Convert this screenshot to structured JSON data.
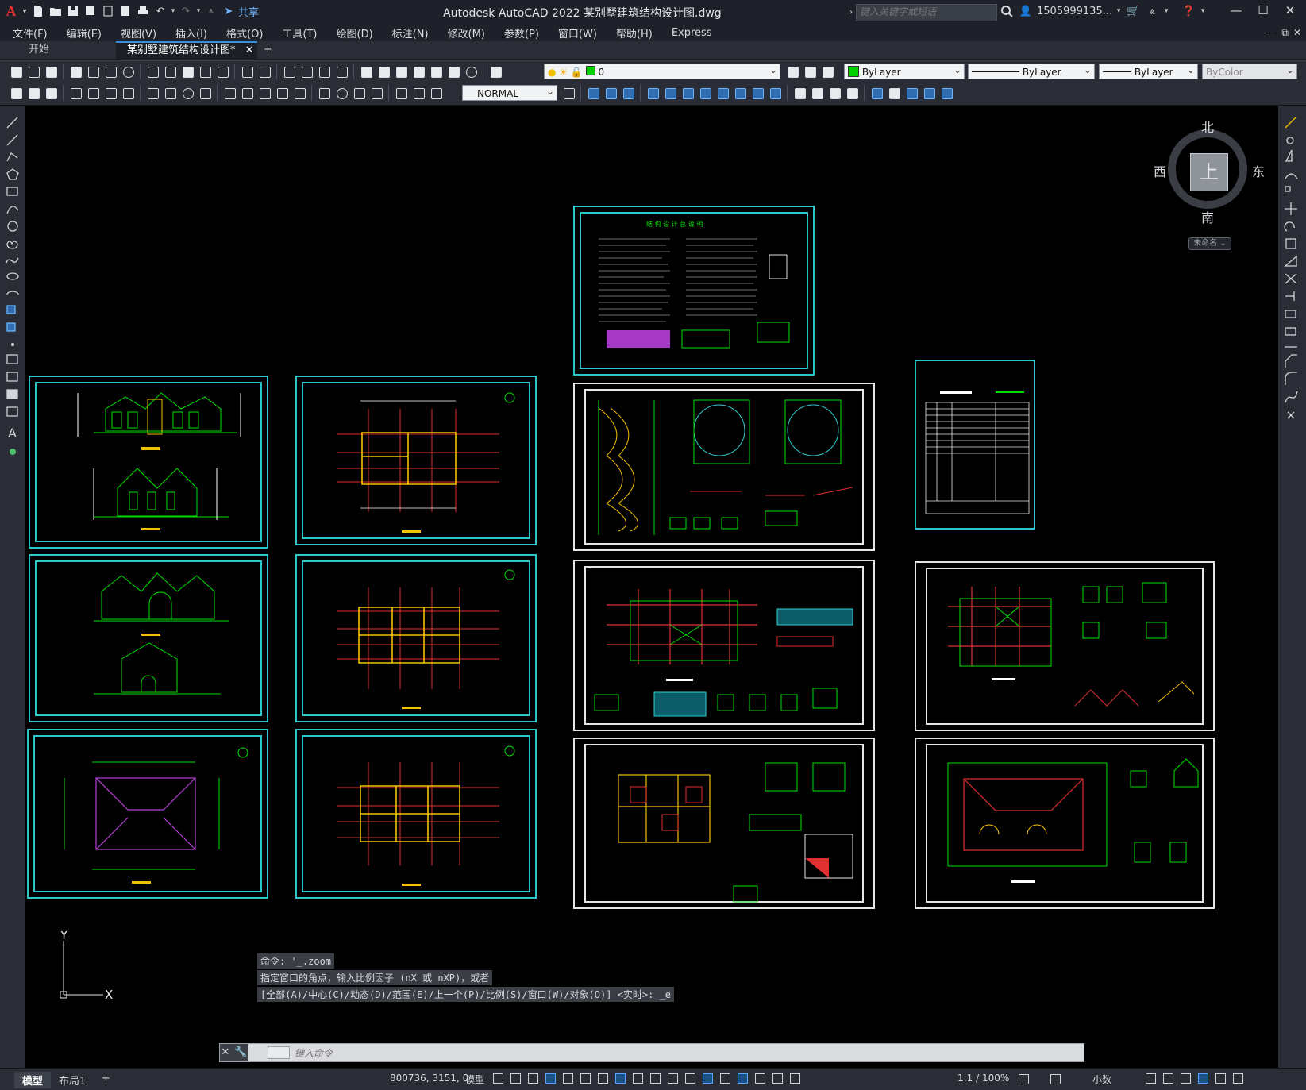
{
  "app": {
    "title": "Autodesk AutoCAD 2022    某别墅建筑结构设计图.dwg",
    "share_label": "共享",
    "search_placeholder": "键入关键字或短语",
    "user": "1505999135...",
    "accent": "#3f8ed8"
  },
  "menu": [
    "文件(F)",
    "编辑(E)",
    "视图(V)",
    "插入(I)",
    "格式(O)",
    "工具(T)",
    "绘图(D)",
    "标注(N)",
    "修改(M)",
    "参数(P)",
    "窗口(W)",
    "帮助(H)",
    "Express"
  ],
  "tabs": {
    "start": "开始",
    "drawing": "某别墅建筑结构设计图*",
    "add": "+"
  },
  "toolbar": {
    "layer": "0",
    "color": "ByLayer",
    "linetype": "ByLayer",
    "lineweight": "ByLayer",
    "plotstyle": "ByColor",
    "dimstyle": "NORMAL"
  },
  "viewcube": {
    "north": "北",
    "south": "南",
    "east": "东",
    "west": "西",
    "face": "上",
    "ucs": "未命名"
  },
  "ucs_icon": {
    "y": "Y",
    "x": "X"
  },
  "sheet_text": {
    "notes_title": "结 构 设 计 总 说 明"
  },
  "command": {
    "history": [
      "命令: '_.zoom",
      "指定窗口的角点，输入比例因子 (nX 或 nXP)，或者",
      "[全部(A)/中心(C)/动态(D)/范围(E)/上一个(P)/比例(S)/窗口(W)/对象(O)] <实时>: _e"
    ],
    "placeholder": "键入命令"
  },
  "status": {
    "model_tab": "模型",
    "layout_tab": "布局1",
    "add_tab": "+",
    "coords": "800736, 3151, 0",
    "space": "模型",
    "scale": "1:1 / 100%",
    "units": "小数"
  }
}
